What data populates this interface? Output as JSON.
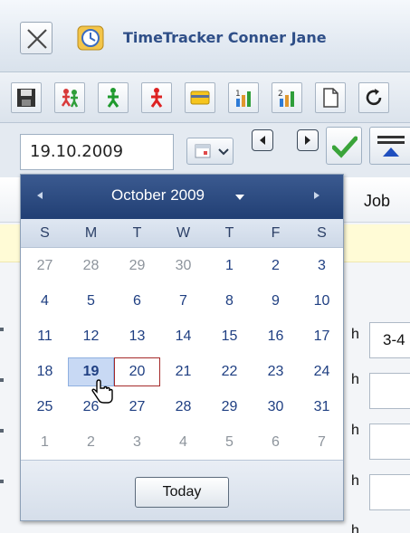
{
  "window": {
    "title": "TimeTracker Conner Jane"
  },
  "toolbar": {
    "buttons": [
      "save-icon",
      "team-icon",
      "walker-green-icon",
      "walker-red-icon",
      "card-icon",
      "chart-1-icon",
      "chart-2-icon",
      "document-icon",
      "refresh-icon"
    ]
  },
  "date_field": {
    "value": "19.10.2009"
  },
  "grid": {
    "column_job": "Job",
    "row_labels": [
      "h",
      "h",
      "h",
      "h",
      "h"
    ],
    "first_row_value": "3-4"
  },
  "calendar": {
    "month_label": "October 2009",
    "weekdays": [
      "S",
      "M",
      "T",
      "W",
      "T",
      "F",
      "S"
    ],
    "weeks": [
      [
        {
          "d": "27",
          "m": true
        },
        {
          "d": "28",
          "m": true
        },
        {
          "d": "29",
          "m": true
        },
        {
          "d": "30",
          "m": true
        },
        {
          "d": "1"
        },
        {
          "d": "2"
        },
        {
          "d": "3"
        }
      ],
      [
        {
          "d": "4"
        },
        {
          "d": "5"
        },
        {
          "d": "6"
        },
        {
          "d": "7"
        },
        {
          "d": "8"
        },
        {
          "d": "9"
        },
        {
          "d": "10"
        }
      ],
      [
        {
          "d": "11"
        },
        {
          "d": "12"
        },
        {
          "d": "13"
        },
        {
          "d": "14"
        },
        {
          "d": "15"
        },
        {
          "d": "16"
        },
        {
          "d": "17"
        }
      ],
      [
        {
          "d": "18"
        },
        {
          "d": "19",
          "sel": true
        },
        {
          "d": "20",
          "today": true
        },
        {
          "d": "21"
        },
        {
          "d": "22"
        },
        {
          "d": "23"
        },
        {
          "d": "24"
        }
      ],
      [
        {
          "d": "25"
        },
        {
          "d": "26"
        },
        {
          "d": "27"
        },
        {
          "d": "28"
        },
        {
          "d": "29"
        },
        {
          "d": "30"
        },
        {
          "d": "31"
        }
      ],
      [
        {
          "d": "1",
          "m": true
        },
        {
          "d": "2",
          "m": true
        },
        {
          "d": "3",
          "m": true
        },
        {
          "d": "4",
          "m": true
        },
        {
          "d": "5",
          "m": true
        },
        {
          "d": "6",
          "m": true
        },
        {
          "d": "7",
          "m": true
        }
      ]
    ],
    "today_button": "Today"
  },
  "colors": {
    "header_blue": "#213f74",
    "title_blue": "#2f4f88",
    "selected_day": "#c8d9f4",
    "today_border": "#a52a2a"
  }
}
